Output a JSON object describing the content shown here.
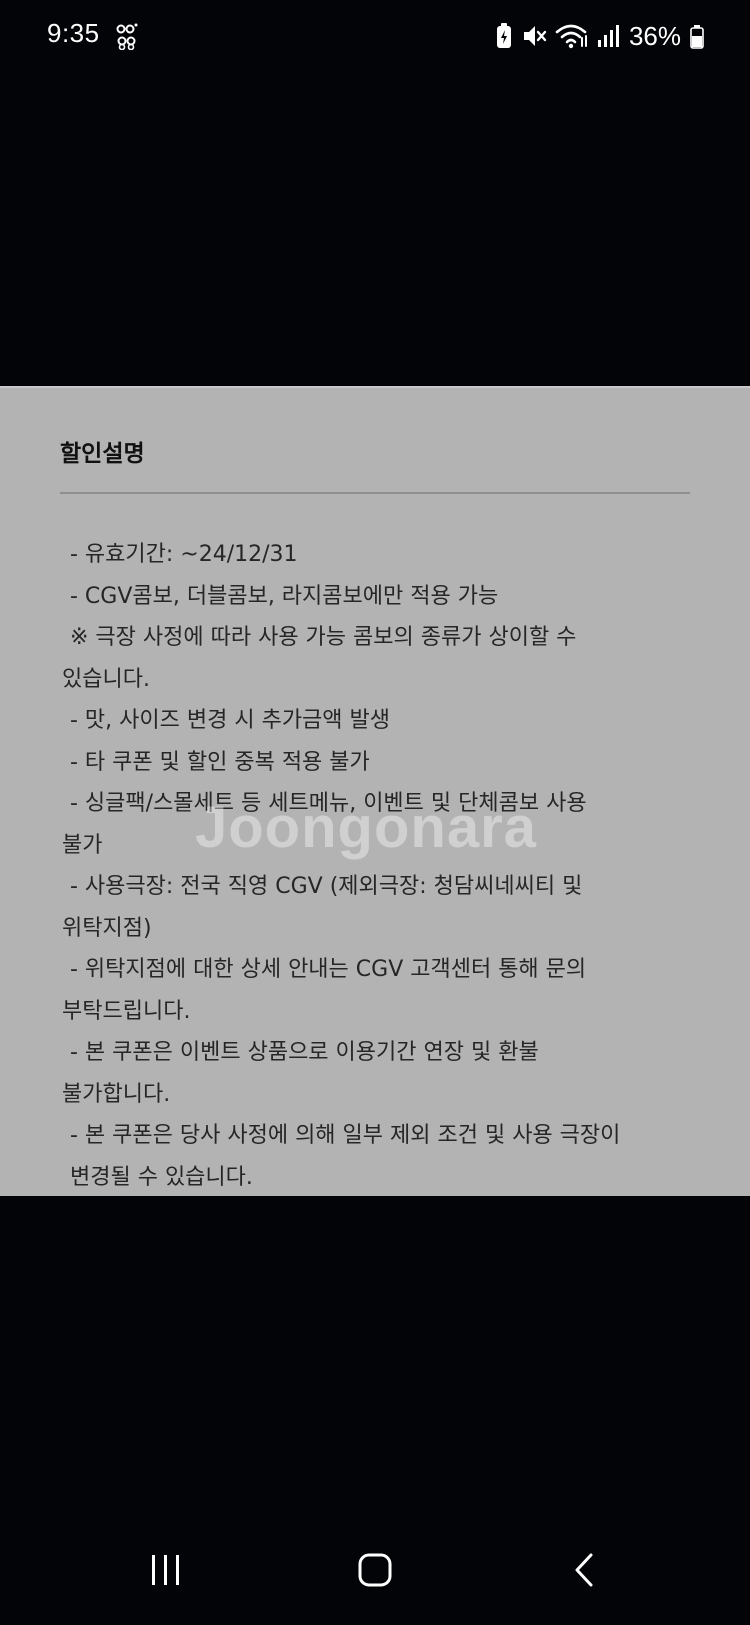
{
  "status_bar": {
    "time": "9:35",
    "battery_percent": "36%",
    "icons": [
      "app-notification-icon",
      "battery-saver-icon",
      "mute-icon",
      "wifi-icon",
      "signal-icon",
      "battery-icon"
    ]
  },
  "panel": {
    "title": "할인설명",
    "lines": [
      "- 유효기간: ~24/12/31",
      "- CGV콤보, 더블콤보, 라지콤보에만 적용 가능",
      "※ 극장 사정에 따라 사용 가능 콤보의 종류가 상이할 수",
      "있습니다.",
      "- 맛, 사이즈 변경 시 추가금액 발생",
      "- 타 쿠폰 및 할인 중복 적용 불가",
      "- 싱글팩/스몰세트 등 세트메뉴, 이벤트 및 단체콤보 사용",
      "불가",
      "- 사용극장: 전국 직영 CGV (제외극장: 청담씨네씨티 및",
      "위탁지점)",
      "- 위탁지점에 대한 상세 안내는 CGV 고객센터 통해 문의",
      "부탁드립니다.",
      "- 본 쿠폰은 이벤트 상품으로 이용기간 연장 및 환불",
      "불가합니다.",
      "- 본 쿠폰은 당사 사정에 의해 일부 제외 조건 및 사용 극장이",
      "변경될 수 있습니다."
    ],
    "watermark": "Joongonara"
  },
  "nav_bar": {
    "icons": [
      "recent-apps-icon",
      "home-icon",
      "back-icon"
    ]
  },
  "colors": {
    "background": "#030408",
    "panel": "#b3b3b3",
    "text": "#262626",
    "title": "#111111"
  }
}
